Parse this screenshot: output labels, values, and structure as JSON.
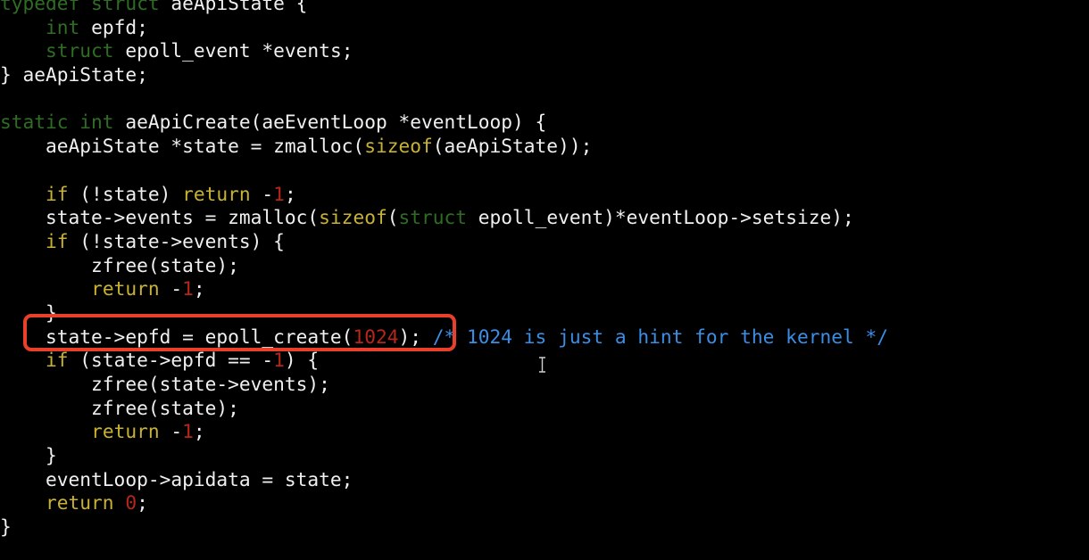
{
  "colors": {
    "background": "#000000",
    "text": "#f0f0f0",
    "keyword": "#2f6d25",
    "statement": "#c9b232",
    "number": "#b8261a",
    "comment": "#3a8ee6",
    "highlight_box": "#e8402a"
  },
  "cursor_icon": "text-cursor-ibeam",
  "lines": [
    [
      [
        "typedef struct",
        "k"
      ],
      [
        " aeApiState {",
        "p"
      ]
    ],
    [
      [
        "    ",
        "p"
      ],
      [
        "int",
        "k"
      ],
      [
        " epfd;",
        "p"
      ]
    ],
    [
      [
        "    ",
        "p"
      ],
      [
        "struct",
        "k"
      ],
      [
        " epoll_event *events;",
        "p"
      ]
    ],
    [
      [
        "} aeApiState;",
        "p"
      ]
    ],
    [],
    [
      [
        "static int",
        "k"
      ],
      [
        " aeApiCreate(aeEventLoop *eventLoop) {",
        "p"
      ]
    ],
    [
      [
        "    aeApiState *state = zmalloc(",
        "p"
      ],
      [
        "sizeof",
        "y"
      ],
      [
        "(aeApiState));",
        "p"
      ]
    ],
    [],
    [
      [
        "    ",
        "p"
      ],
      [
        "if",
        "y"
      ],
      [
        " (!state) ",
        "p"
      ],
      [
        "return",
        "y"
      ],
      [
        " -",
        "p"
      ],
      [
        "1",
        "n"
      ],
      [
        ";",
        "p"
      ]
    ],
    [
      [
        "    state->events = zmalloc(",
        "p"
      ],
      [
        "sizeof",
        "y"
      ],
      [
        "(",
        "p"
      ],
      [
        "struct",
        "k"
      ],
      [
        " epoll_event)*eventLoop->setsize);",
        "p"
      ]
    ],
    [
      [
        "    ",
        "p"
      ],
      [
        "if",
        "y"
      ],
      [
        " (!state->events) {",
        "p"
      ]
    ],
    [
      [
        "        zfree(state);",
        "p"
      ]
    ],
    [
      [
        "        ",
        "p"
      ],
      [
        "return",
        "y"
      ],
      [
        " -",
        "p"
      ],
      [
        "1",
        "n"
      ],
      [
        ";",
        "p"
      ]
    ],
    [
      [
        "    }",
        "p"
      ]
    ],
    [
      [
        "    state->epfd = epoll_create(",
        "p"
      ],
      [
        "1024",
        "n"
      ],
      [
        "); ",
        "p"
      ],
      [
        "/* 1024 is just a hint for the kernel */",
        "c"
      ]
    ],
    [
      [
        "    ",
        "p"
      ],
      [
        "if",
        "y"
      ],
      [
        " (state->epfd == -",
        "p"
      ],
      [
        "1",
        "n"
      ],
      [
        ") {",
        "p"
      ]
    ],
    [
      [
        "        zfree(state->events);",
        "p"
      ]
    ],
    [
      [
        "        zfree(state);",
        "p"
      ]
    ],
    [
      [
        "        ",
        "p"
      ],
      [
        "return",
        "y"
      ],
      [
        " -",
        "p"
      ],
      [
        "1",
        "n"
      ],
      [
        ";",
        "p"
      ]
    ],
    [
      [
        "    }",
        "p"
      ]
    ],
    [
      [
        "    eventLoop->apidata = state;",
        "p"
      ]
    ],
    [
      [
        "    ",
        "p"
      ],
      [
        "return",
        "y"
      ],
      [
        " ",
        "p"
      ],
      [
        "0",
        "n"
      ],
      [
        ";",
        "p"
      ]
    ],
    [
      [
        "}",
        "p"
      ]
    ]
  ]
}
